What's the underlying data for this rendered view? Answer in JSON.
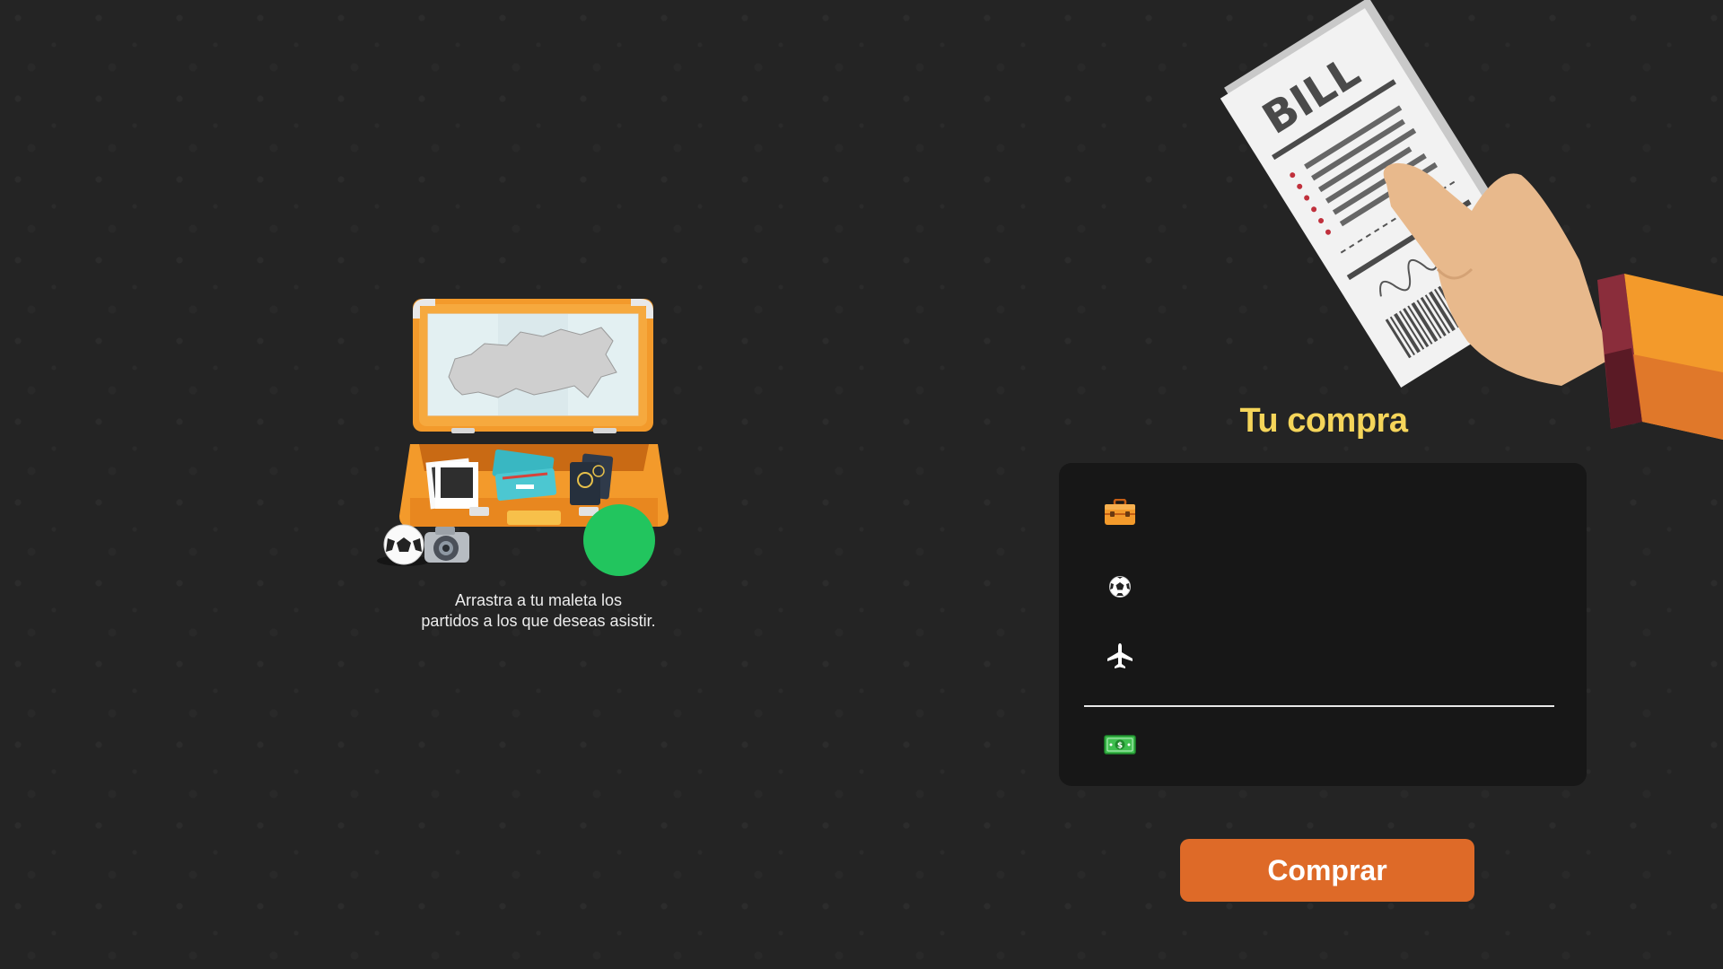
{
  "suitcase": {
    "instruction_line1": "Arrastra a tu maleta los",
    "instruction_line2": "partidos a los que deseas asistir."
  },
  "bill_illustration": {
    "label": "BILL"
  },
  "summary": {
    "title": "Tu compra",
    "rows": [
      {
        "icon": "suitcase-icon",
        "value": ""
      },
      {
        "icon": "soccer-ball-icon",
        "value": ""
      },
      {
        "icon": "airplane-icon",
        "value": ""
      },
      {
        "icon": "money-icon",
        "value": ""
      }
    ]
  },
  "actions": {
    "buy_label": "Comprar"
  },
  "colors": {
    "background": "#242424",
    "title": "#f5d55a",
    "panel": "#171717",
    "button": "#de6a28",
    "drop_zone": "#22c55e",
    "suitcase": "#f39a2b"
  },
  "icons": [
    "suitcase-icon",
    "soccer-ball-icon",
    "airplane-icon",
    "money-icon",
    "camera-icon",
    "map-icon",
    "passport-icon",
    "tickets-icon",
    "photos-icon",
    "hand-icon",
    "receipt-icon"
  ]
}
